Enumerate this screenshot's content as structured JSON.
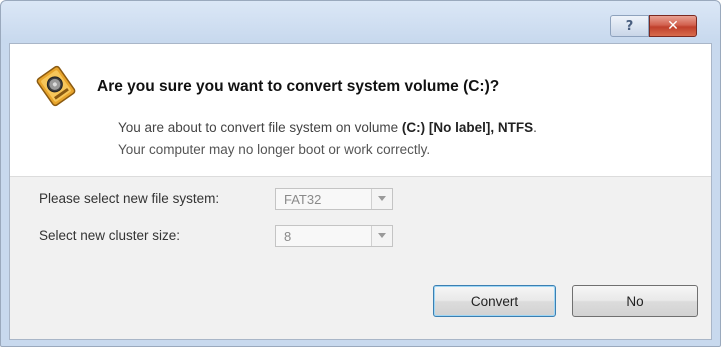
{
  "titlebar": {
    "help_label": "?",
    "close_label": "✕"
  },
  "dialog": {
    "heading": "Are you sure you want to convert system volume (C:)?",
    "message_prefix": "You are about to convert file system on volume ",
    "message_volume": "(C:) [No label], NTFS",
    "message_suffix": ".",
    "message_line2": "Your computer may no longer boot or work correctly."
  },
  "form": {
    "filesystem_label": "Please select new file system:",
    "filesystem_value": "FAT32",
    "cluster_label": "Select new cluster size:",
    "cluster_value": "8"
  },
  "buttons": {
    "convert_label": "Convert",
    "no_label": "No"
  },
  "colors": {
    "title_bg": "#c8d9ee",
    "close_button": "#c0402c",
    "default_button_border": "#3c7fb1"
  },
  "icons": {
    "warning": "hard-drive-warning-icon",
    "help": "help-icon",
    "close": "close-icon",
    "dropdown": "chevron-down-icon"
  }
}
